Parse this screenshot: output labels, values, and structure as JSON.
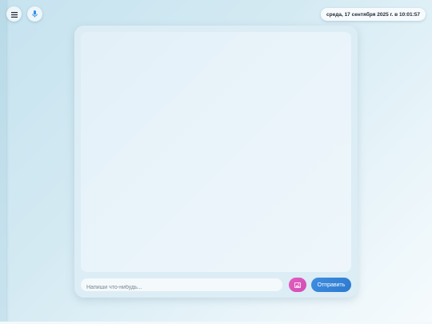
{
  "topbar": {
    "menu_icon": "hamburger-menu-icon",
    "mic_icon": "microphone-icon",
    "datetime": "среда, 17 сентября 2025 г. в 10:01:57"
  },
  "chat": {
    "input_placeholder": "Напиши что-нибудь...",
    "input_value": "",
    "image_button_icon": "image-icon",
    "send_label": "Отправить"
  },
  "colors": {
    "image_button": "#d851b9",
    "send_button": "#3483d8",
    "mic_icon": "#2f8fe8"
  }
}
